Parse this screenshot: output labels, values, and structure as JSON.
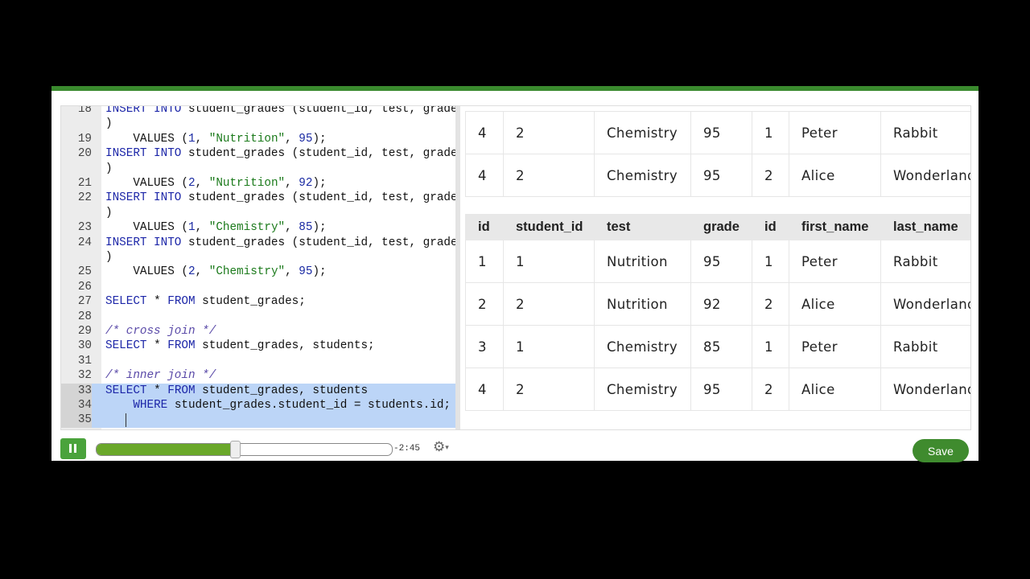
{
  "editor": {
    "lines": [
      {
        "num": "18",
        "segments": [
          {
            "t": "INSERT INTO student_grades (student_id, test, grade",
            "c": "kw-partial"
          }
        ]
      },
      {
        "num": "",
        "segments": [
          {
            "t": ")"
          }
        ]
      },
      {
        "num": "19",
        "segments": [
          {
            "t": "    VALUES ("
          },
          {
            "t": "1",
            "c": "num"
          },
          {
            "t": ", "
          },
          {
            "t": "\"Nutrition\"",
            "c": "str"
          },
          {
            "t": ", "
          },
          {
            "t": "95",
            "c": "num"
          },
          {
            "t": ");"
          }
        ]
      },
      {
        "num": "20",
        "segments": [
          {
            "t": "INSERT INTO",
            "c": "kw"
          },
          {
            "t": " student_grades (student_id, test, grade"
          }
        ]
      },
      {
        "num": "",
        "segments": [
          {
            "t": ")"
          }
        ]
      },
      {
        "num": "21",
        "segments": [
          {
            "t": "    VALUES ("
          },
          {
            "t": "2",
            "c": "num"
          },
          {
            "t": ", "
          },
          {
            "t": "\"Nutrition\"",
            "c": "str"
          },
          {
            "t": ", "
          },
          {
            "t": "92",
            "c": "num"
          },
          {
            "t": ");"
          }
        ]
      },
      {
        "num": "22",
        "segments": [
          {
            "t": "INSERT INTO",
            "c": "kw"
          },
          {
            "t": " student_grades (student_id, test, grade"
          }
        ]
      },
      {
        "num": "",
        "segments": [
          {
            "t": ")"
          }
        ]
      },
      {
        "num": "23",
        "segments": [
          {
            "t": "    VALUES ("
          },
          {
            "t": "1",
            "c": "num"
          },
          {
            "t": ", "
          },
          {
            "t": "\"Chemistry\"",
            "c": "str"
          },
          {
            "t": ", "
          },
          {
            "t": "85",
            "c": "num"
          },
          {
            "t": ");"
          }
        ]
      },
      {
        "num": "24",
        "segments": [
          {
            "t": "INSERT INTO",
            "c": "kw"
          },
          {
            "t": " student_grades (student_id, test, grade"
          }
        ]
      },
      {
        "num": "",
        "segments": [
          {
            "t": ")"
          }
        ]
      },
      {
        "num": "25",
        "segments": [
          {
            "t": "    VALUES ("
          },
          {
            "t": "2",
            "c": "num"
          },
          {
            "t": ", "
          },
          {
            "t": "\"Chemistry\"",
            "c": "str"
          },
          {
            "t": ", "
          },
          {
            "t": "95",
            "c": "num"
          },
          {
            "t": ");"
          }
        ]
      },
      {
        "num": "26",
        "segments": []
      },
      {
        "num": "27",
        "segments": [
          {
            "t": "SELECT",
            "c": "kw"
          },
          {
            "t": " * "
          },
          {
            "t": "FROM",
            "c": "kw"
          },
          {
            "t": " student_grades;"
          }
        ]
      },
      {
        "num": "28",
        "segments": []
      },
      {
        "num": "29",
        "segments": [
          {
            "t": "/* cross join */",
            "c": "com"
          }
        ]
      },
      {
        "num": "30",
        "segments": [
          {
            "t": "SELECT",
            "c": "kw"
          },
          {
            "t": " * "
          },
          {
            "t": "FROM",
            "c": "kw"
          },
          {
            "t": " student_grades, students;"
          }
        ]
      },
      {
        "num": "31",
        "segments": []
      },
      {
        "num": "32",
        "segments": [
          {
            "t": "/* inner join */",
            "c": "com"
          }
        ]
      },
      {
        "num": "33",
        "hl": true,
        "segments": [
          {
            "t": "SELECT",
            "c": "kw"
          },
          {
            "t": " * "
          },
          {
            "t": "FROM",
            "c": "kw"
          },
          {
            "t": " student_grades, students"
          }
        ]
      },
      {
        "num": "34",
        "hl": true,
        "segments": [
          {
            "t": "    "
          },
          {
            "t": "WHERE",
            "c": "kw"
          },
          {
            "t": " student_grades.student_id = students.id;"
          }
        ]
      },
      {
        "num": "35",
        "hl": true,
        "segments": []
      }
    ]
  },
  "results": {
    "upper_rows": [
      [
        "4",
        "2",
        "Chemistry",
        "95",
        "1",
        "Peter",
        "Rabbit"
      ],
      [
        "4",
        "2",
        "Chemistry",
        "95",
        "2",
        "Alice",
        "Wonderland"
      ]
    ],
    "headers": [
      "id",
      "student_id",
      "test",
      "grade",
      "id",
      "first_name",
      "last_name"
    ],
    "rows": [
      [
        "1",
        "1",
        "Nutrition",
        "95",
        "1",
        "Peter",
        "Rabbit"
      ],
      [
        "2",
        "2",
        "Nutrition",
        "92",
        "2",
        "Alice",
        "Wonderland"
      ],
      [
        "3",
        "1",
        "Chemistry",
        "85",
        "1",
        "Peter",
        "Rabbit"
      ],
      [
        "4",
        "2",
        "Chemistry",
        "95",
        "2",
        "Alice",
        "Wonderland"
      ]
    ]
  },
  "player": {
    "progress": 0.47,
    "time_remaining": "-2:45",
    "play_state_icon": "pause-icon",
    "settings_icon": "gear-icon"
  },
  "save_label": "Save",
  "colors": {
    "accent": "#3f8b2e",
    "progress": "#6aa82a",
    "highlight": "#bcd5f7"
  }
}
